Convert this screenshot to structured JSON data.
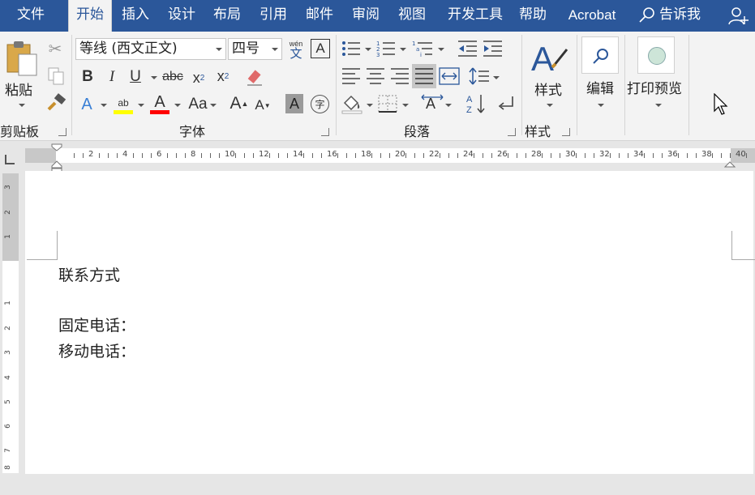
{
  "menu": {
    "items": [
      "文件",
      "开始",
      "插入",
      "设计",
      "布局",
      "引用",
      "邮件",
      "审阅",
      "视图",
      "开发工具",
      "帮助",
      "Acrobat"
    ],
    "active": "开始",
    "tell_me": "告诉我"
  },
  "ribbon": {
    "clipboard": {
      "paste_label": "粘贴",
      "group_label": "剪贴板"
    },
    "font": {
      "font_name": "等线 (西文正文)",
      "font_size": "四号",
      "wen_label": "wén",
      "wen_char": "文",
      "case_label": "Aa",
      "circle_char": "字",
      "group_label": "字体"
    },
    "paragraph": {
      "group_label": "段落"
    },
    "styles": {
      "styles_label": "样式",
      "group_label": "样式"
    },
    "editing": {
      "label": "编辑"
    },
    "print_preview": {
      "label": "打印预览"
    }
  },
  "ruler": {
    "numbers": [
      "2",
      "4",
      "6",
      "8",
      "10",
      "12",
      "14",
      "16",
      "18",
      "20",
      "22",
      "24",
      "26",
      "28",
      "30",
      "32",
      "34",
      "36",
      "38",
      "40"
    ],
    "vertical_numbers": [
      "3",
      "2",
      "1",
      "1",
      "2",
      "3",
      "4",
      "5",
      "6",
      "7",
      "8"
    ]
  },
  "document": {
    "lines": [
      "联系方式",
      "",
      "固定电话：",
      "移动电话："
    ]
  },
  "colors": {
    "title_bar": "#2b579a",
    "ribbon_bg": "#f3f3f3",
    "highlight_yellow": "#ffff00",
    "font_color_red": "#ff0000"
  }
}
